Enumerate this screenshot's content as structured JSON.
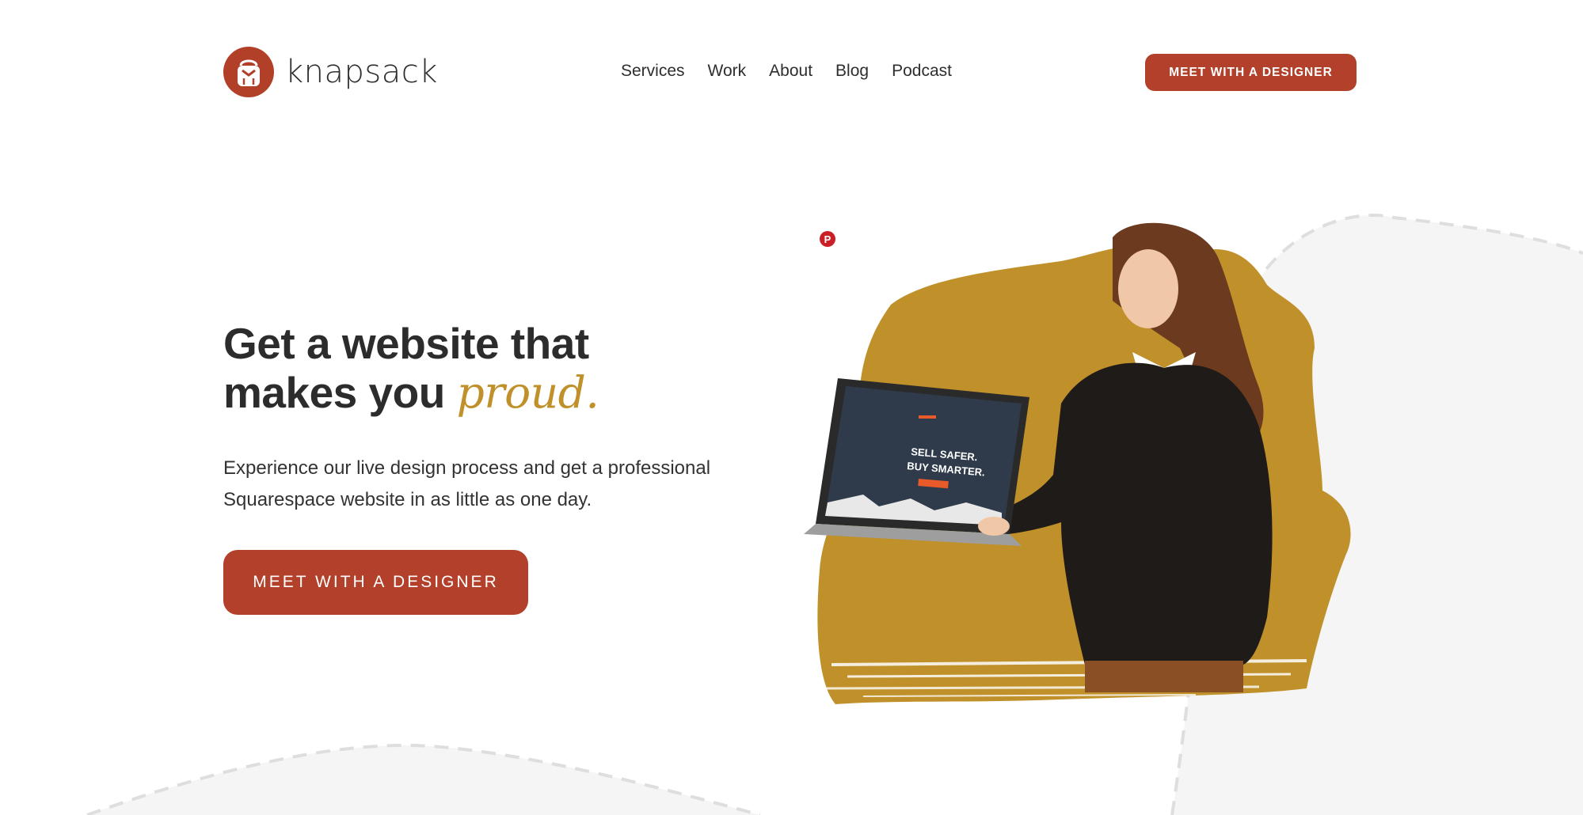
{
  "brand": {
    "name": "knapsack",
    "accent_color": "#b2402a",
    "gold_color": "#c0912b"
  },
  "nav": {
    "items": [
      {
        "label": "Services"
      },
      {
        "label": "Work"
      },
      {
        "label": "About"
      },
      {
        "label": "Blog"
      },
      {
        "label": "Podcast"
      }
    ],
    "cta_label": "MEET WITH A DESIGNER"
  },
  "hero": {
    "title_line1": "Get a website that",
    "title_line2_plain": "makes you ",
    "title_line2_accent": "proud.",
    "subtitle": "Experience our live design process and get a professional Squarespace website in as little as one day.",
    "cta_label": "MEET WITH A DESIGNER"
  },
  "laptop_screen": {
    "headline_line1": "SELL SAFER.",
    "headline_line2": "BUY SMARTER."
  },
  "icons": {
    "pinterest": "pinterest-icon",
    "logo": "backpack-logo-icon"
  }
}
